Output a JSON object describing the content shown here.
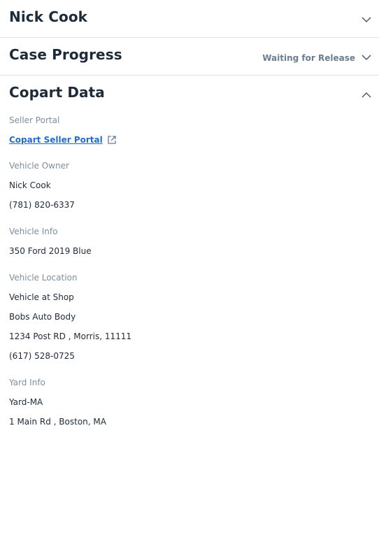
{
  "sections": {
    "owner": {
      "title": "Nick Cook"
    },
    "case_progress": {
      "title": "Case Progress",
      "status": "Waiting for Release"
    },
    "copart": {
      "title": "Copart Data"
    }
  },
  "copart": {
    "seller_portal": {
      "label": "Seller Portal",
      "link_text": "Copart Seller Portal"
    },
    "vehicle_owner": {
      "label": "Vehicle Owner",
      "name": "Nick Cook",
      "phone": "(781) 820-6337"
    },
    "vehicle_info": {
      "label": "Vehicle Info",
      "desc": "350 Ford 2019 Blue"
    },
    "vehicle_location": {
      "label": "Vehicle Location",
      "status": "Vehicle at Shop",
      "shop": "Bobs Auto Body",
      "address": "1234 Post RD , Morris, 11111",
      "phone": "(617) 528-0725"
    },
    "yard_info": {
      "label": "Yard Info",
      "name": "Yard-MA",
      "address": "1 Main Rd , Boston, MA"
    }
  },
  "colors": {
    "accent_link": "#1f6fd0",
    "label_gray": "#7f8e9f",
    "divider": "#dfe3e8"
  },
  "icons": {
    "collapse": "chevron-down-icon",
    "expand": "chevron-up-icon",
    "external": "external-link-icon"
  }
}
